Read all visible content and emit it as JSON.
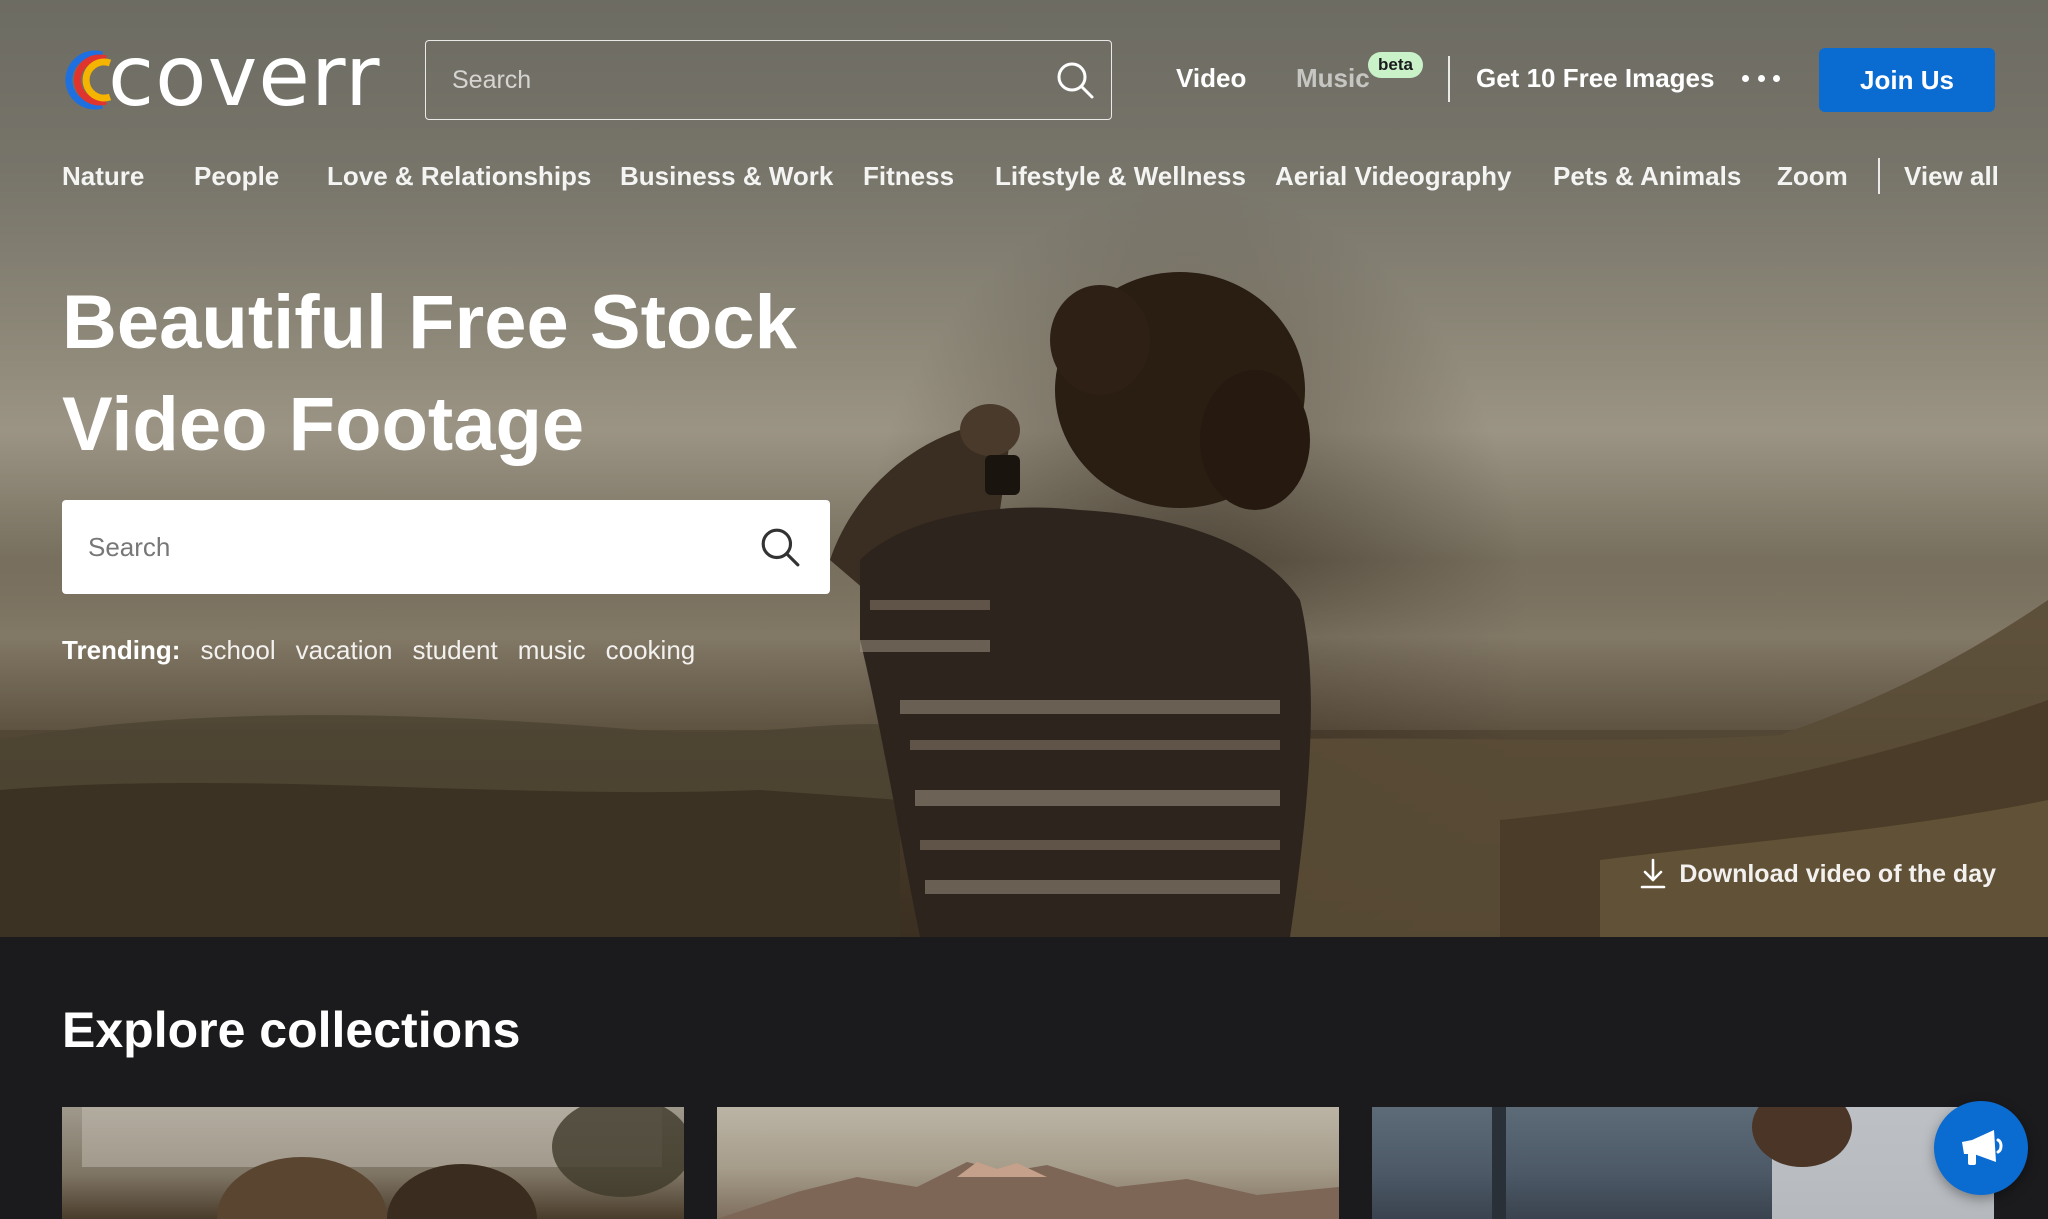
{
  "brand": {
    "name": "coverr"
  },
  "header": {
    "search_placeholder": "Search",
    "nav": {
      "video": "Video",
      "music": "Music",
      "music_badge": "beta",
      "free_images": "Get 10 Free Images"
    },
    "join_label": "Join Us"
  },
  "categories": [
    "Nature",
    "People",
    "Love & Relationships",
    "Business & Work",
    "Fitness",
    "Lifestyle & Wellness",
    "Aerial Videography",
    "Pets & Animals",
    "Zoom",
    "View all"
  ],
  "hero": {
    "title_line1": "Beautiful Free Stock",
    "title_line2": "Video Footage",
    "search_placeholder": "Search",
    "trending_label": "Trending:",
    "trending": [
      "school",
      "vacation",
      "student",
      "music",
      "cooking"
    ],
    "download_label": "Download video of the day"
  },
  "explore": {
    "title": "Explore collections"
  },
  "colors": {
    "accent": "#0a6bd0",
    "beta_badge": "#c9f2c9",
    "dark_bg": "#1b1b1e"
  },
  "icons": [
    "search-icon",
    "more-dots-icon",
    "download-icon",
    "megaphone-icon",
    "coverr-logo-mark"
  ]
}
